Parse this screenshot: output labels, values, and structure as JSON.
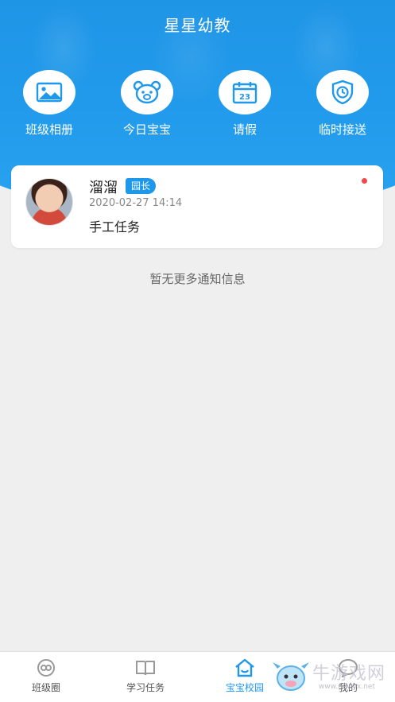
{
  "header": {
    "title": "星星幼教"
  },
  "quick_actions": [
    {
      "label": "班级相册",
      "icon": "photo-album-icon"
    },
    {
      "label": "今日宝宝",
      "icon": "bear-face-icon"
    },
    {
      "label": "请假",
      "icon": "calendar-icon",
      "icon_text": "23"
    },
    {
      "label": "临时接送",
      "icon": "shield-clock-icon"
    }
  ],
  "notice": {
    "sender": "溜溜",
    "badge": "园长",
    "time": "2020-02-27 14:14",
    "content": "手工任务",
    "unread": true
  },
  "empty_note": "暂无更多通知信息",
  "tabbar": {
    "items": [
      {
        "label": "班级圈",
        "icon": "class-circle-icon",
        "active": false
      },
      {
        "label": "学习任务",
        "icon": "book-icon",
        "active": false
      },
      {
        "label": "宝宝校园",
        "icon": "school-home-icon",
        "active": true
      },
      {
        "label": "我的",
        "icon": "profile-chat-icon",
        "active": false
      }
    ]
  },
  "watermark": {
    "text": "牛游戏网",
    "sub": "www.newyx.net"
  },
  "colors": {
    "primary": "#1e98ea",
    "header_blue": "#229bec",
    "unread_dot": "#f04848",
    "background": "#efefef"
  }
}
